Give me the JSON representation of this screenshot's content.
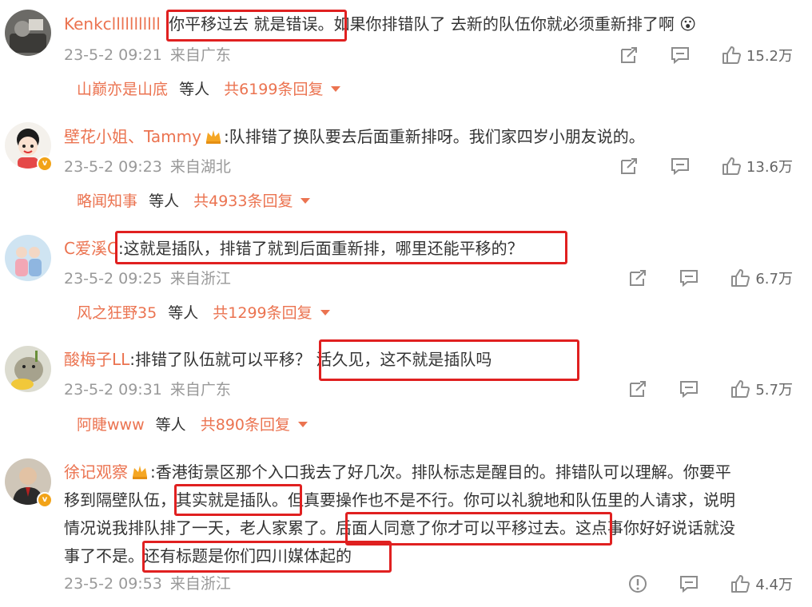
{
  "comments": [
    {
      "user": "Kenkclllllllllll",
      "lines": [
        "你平移过去 就是错误。如果你排错队了 去新的队伍你就必须重新排了啊"
      ],
      "line_emoji": "😮",
      "date": "23-5-2 09:21",
      "location": "来自广东",
      "likes": "15.2万",
      "reply_user": "山巅亦是山底",
      "reply_mid": "等人",
      "reply_total": "共6199条回复"
    },
    {
      "user": "壁花小姐、Tammy",
      "lines": [
        ":队排错了换队要去后面重新排呀。我们家四岁小朋友说的。"
      ],
      "date": "23-5-2 09:23",
      "location": "来自湖北",
      "likes": "13.6万",
      "reply_user": "略闻知事",
      "reply_mid": "等人",
      "reply_total": "共4933条回复"
    },
    {
      "user": "C爱溪C",
      "lines": [
        ":这就是插队，排错了就到后面重新排，哪里还能平移的？"
      ],
      "date": "23-5-2 09:25",
      "location": "来自浙江",
      "likes": "6.7万",
      "reply_user": "风之狂野35",
      "reply_mid": "等人",
      "reply_total": "共1299条回复"
    },
    {
      "user": "酸梅子LL",
      "lines": [
        ":排错了队伍就可以平移？ 活久见，这不就是插队吗"
      ],
      "date": "23-5-2 09:31",
      "location": "来自广东",
      "likes": "5.7万",
      "reply_user": "阿睫www",
      "reply_mid": "等人",
      "reply_total": "共890条回复"
    },
    {
      "user": "徐记观察",
      "lines": [
        ":香港街景区那个入口我去了好几次。排队标志是醒目的。排错队可以理解。你要平",
        "移到隔壁队伍，其实就是插队。但真要操作也不是不行。你可以礼貌地和队伍里的人请求，说明",
        "情况说我排队排了一天，老人家累了。后面人同意了你才可以平移过去。这点事你好好说话就没",
        "事了不是。还有标题是你们四川媒体起的"
      ],
      "date": "23-5-2 09:53",
      "location": "来自浙江",
      "likes": "4.4万"
    }
  ],
  "colors": {
    "username": "#eb7350",
    "text": "#333333",
    "meta": "#999999",
    "highlight": "#e02020"
  },
  "icons": [
    "repost-icon",
    "comment-icon",
    "like-icon",
    "report-icon",
    "verified-badge-icon",
    "crown-icon"
  ]
}
